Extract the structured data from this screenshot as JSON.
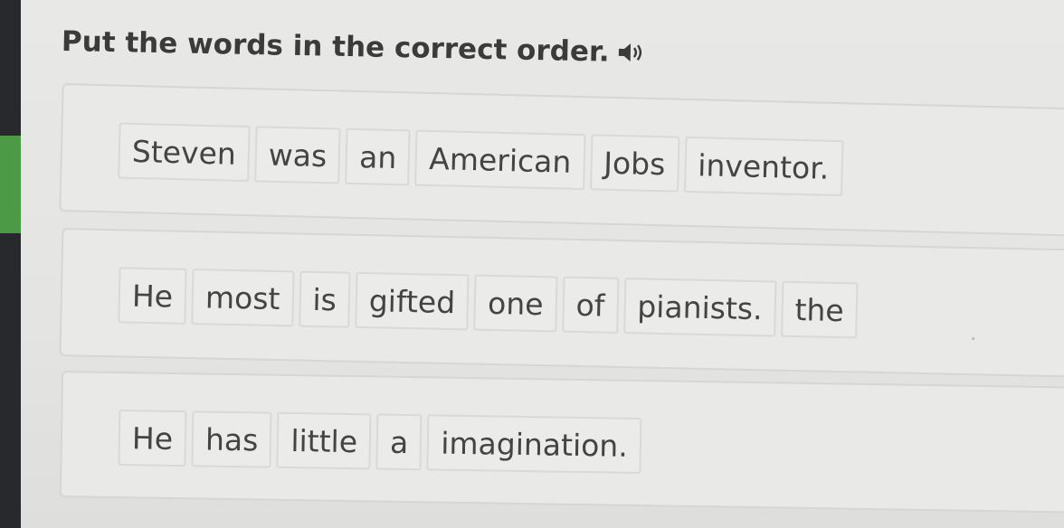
{
  "exercise": {
    "instruction": "Put the words in the correct order.",
    "audio_icon": "speaker-icon"
  },
  "sentences": [
    {
      "words": [
        "Steven",
        "was",
        "an",
        "American",
        "Jobs",
        "inventor."
      ]
    },
    {
      "words": [
        "He",
        "most",
        "is",
        "gifted",
        "one",
        "of",
        "pianists.",
        "the"
      ]
    },
    {
      "words": [
        "He",
        "has",
        "little",
        "a",
        "imagination."
      ]
    }
  ],
  "colors": {
    "sidebar": "#27292c",
    "sidebar_accent": "#4c9a45",
    "background": "#e4e4e2",
    "card": "#e9e9e7",
    "tile": "#ebebea",
    "text": "#3e3e3e"
  }
}
